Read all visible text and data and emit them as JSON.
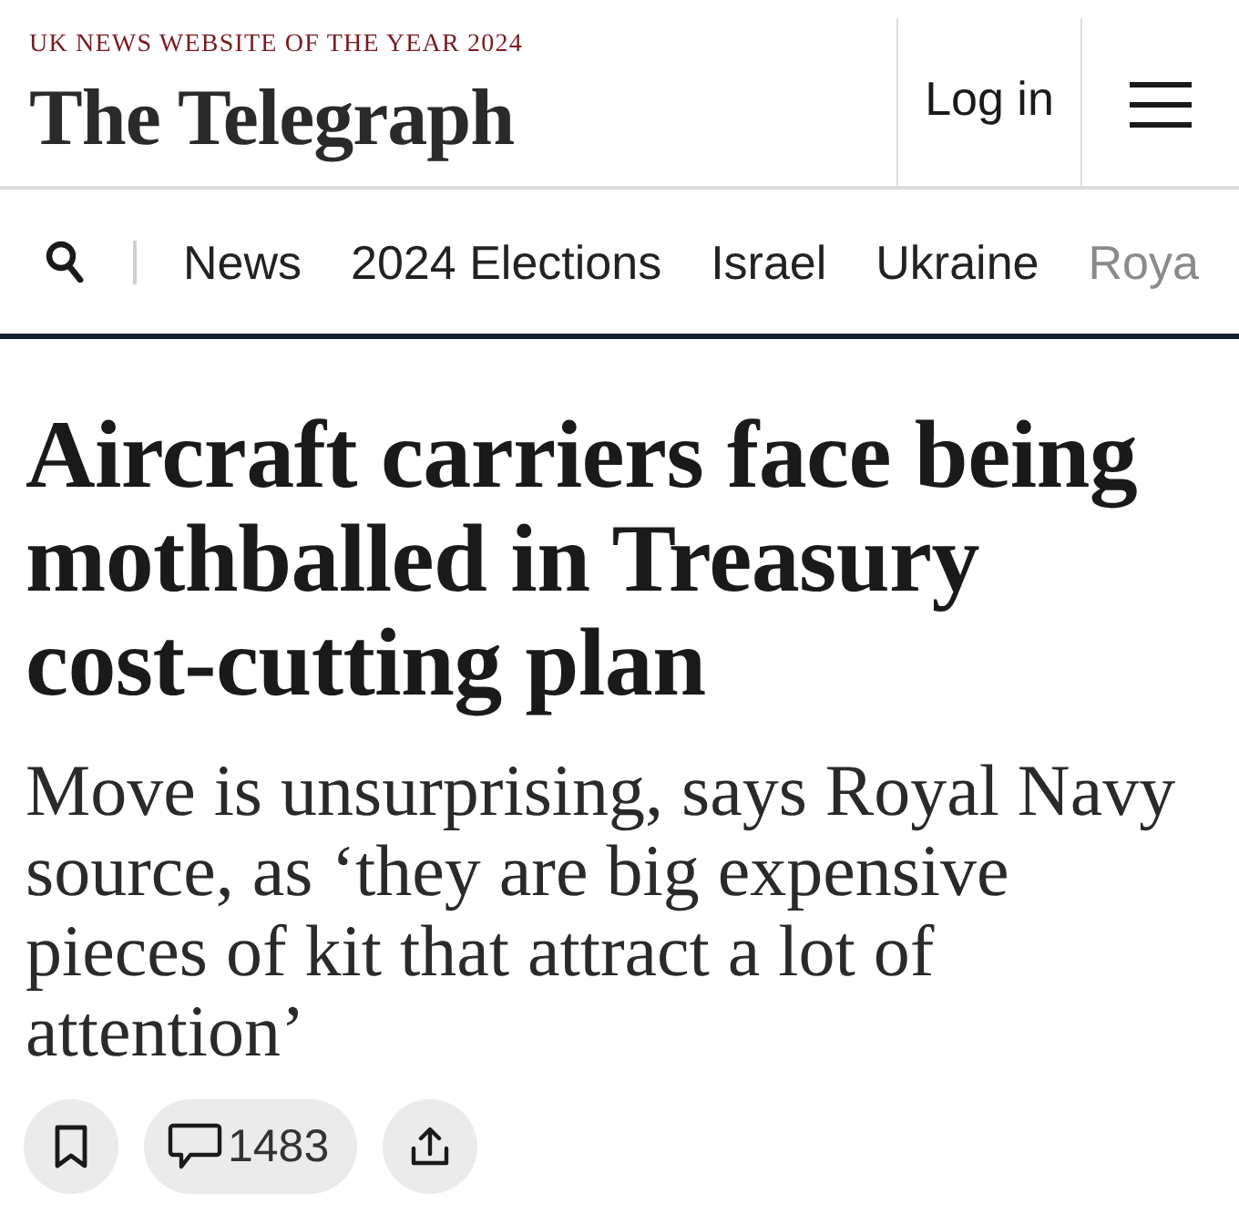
{
  "header": {
    "award": "UK NEWS WEBSITE OF THE YEAR 2024",
    "logo": "The Telegraph",
    "login": "Log in"
  },
  "nav": {
    "items": [
      "News",
      "2024 Elections",
      "Israel",
      "Ukraine",
      "Roya"
    ]
  },
  "article": {
    "headline": "Aircraft carriers face being mothballed in Treasury cost-cutting plan",
    "standfirst": "Move is unsurprising, says Royal Navy source, as ‘they are big expensive pieces of kit that attract a lot of attention’"
  },
  "actions": [
    {
      "kind": "bookmark"
    },
    {
      "kind": "comments",
      "count": "1483"
    },
    {
      "kind": "share"
    }
  ]
}
